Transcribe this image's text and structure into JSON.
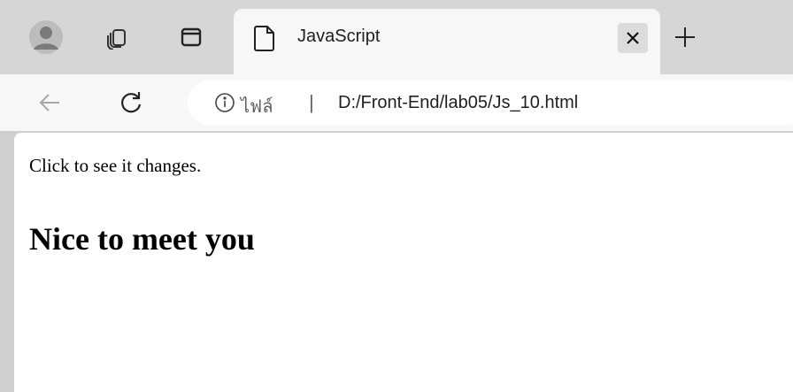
{
  "tab": {
    "title": "JavaScript",
    "favicon": "page-icon"
  },
  "toolbar": {
    "back_icon": "back-arrow-icon",
    "reload_icon": "reload-icon"
  },
  "address": {
    "scheme_label": "ไฟล์",
    "separator": "|",
    "url": "D:/Front-End/lab05/Js_10.html"
  },
  "page": {
    "intro_text": "Click to see it changes.",
    "heading": "Nice to meet you"
  },
  "colors": {
    "tabstrip_bg": "#d6d6d6",
    "active_tab_bg": "#f7f7f7",
    "content_bg": "#ffffff"
  }
}
